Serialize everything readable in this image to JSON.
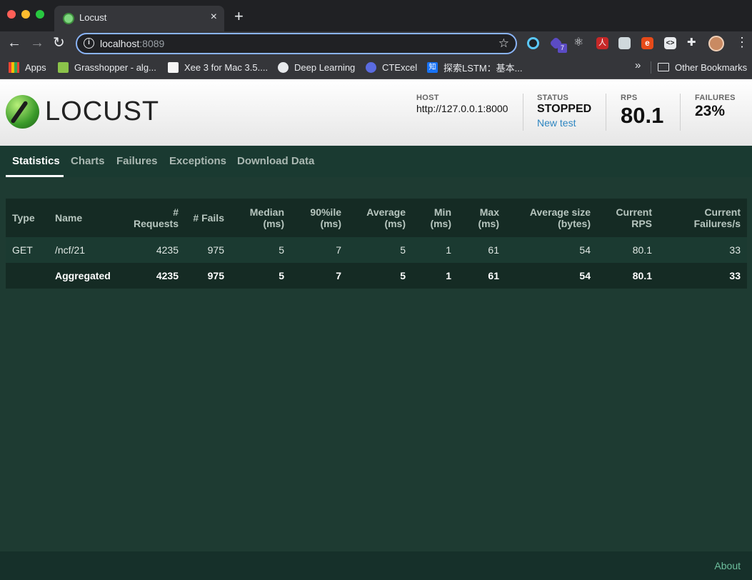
{
  "browser": {
    "tab_title": "Locust",
    "tab_close": "×",
    "new_tab": "+",
    "url_host": "localhost",
    "url_port": ":8089",
    "bookmarks": [
      {
        "label": "Apps"
      },
      {
        "label": "Grasshopper - alg..."
      },
      {
        "label": "Xee 3 for Mac 3.5...."
      },
      {
        "label": "Deep Learning"
      },
      {
        "label": "CTExcel"
      },
      {
        "label": "探索LSTM：基本..."
      }
    ],
    "bookmarks_more": "»",
    "other_bookmarks": "Other Bookmarks",
    "extension_badge": "7"
  },
  "header": {
    "logo_text": "LOCUST",
    "host_label": "HOST",
    "host_value": "http://127.0.0.1:8000",
    "status_label": "STATUS",
    "status_value": "STOPPED",
    "new_test": "New test",
    "rps_label": "RPS",
    "rps_value": "80.1",
    "failures_label": "FAILURES",
    "failures_value": "23%"
  },
  "tabs": [
    {
      "label": "Statistics",
      "active": true
    },
    {
      "label": "Charts"
    },
    {
      "label": "Failures"
    },
    {
      "label": "Exceptions"
    },
    {
      "label": "Download Data"
    }
  ],
  "table": {
    "headers": {
      "type": "Type",
      "name": "Name",
      "requests": "# Requests",
      "fails": "# Fails",
      "median_1": "Median",
      "median_2": "(ms)",
      "p90_1": "90%ile",
      "p90_2": "(ms)",
      "avg_1": "Average",
      "avg_2": "(ms)",
      "min_1": "Min",
      "min_2": "(ms)",
      "max_1": "Max",
      "max_2": "(ms)",
      "size_1": "Average size",
      "size_2": "(bytes)",
      "rps_1": "Current",
      "rps_2": "RPS",
      "fps_1": "Current",
      "fps_2": "Failures/s"
    },
    "rows": [
      {
        "type": "GET",
        "name": "/ncf/21",
        "requests": "4235",
        "fails": "975",
        "median": "5",
        "p90": "7",
        "avg": "5",
        "min": "1",
        "max": "61",
        "size": "54",
        "rps": "80.1",
        "fps": "33"
      },
      {
        "type": "",
        "name": "Aggregated",
        "requests": "4235",
        "fails": "975",
        "median": "5",
        "p90": "7",
        "avg": "5",
        "min": "1",
        "max": "61",
        "size": "54",
        "rps": "80.1",
        "fps": "33"
      }
    ]
  },
  "footer": {
    "about": "About"
  }
}
